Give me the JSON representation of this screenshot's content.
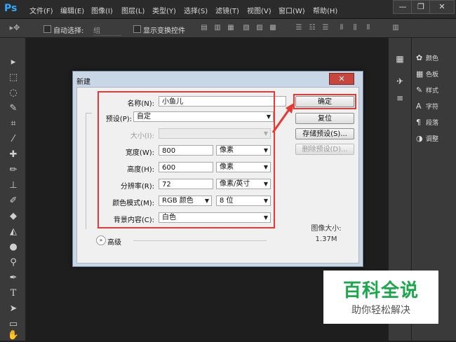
{
  "app": {
    "logo": "Ps"
  },
  "menu": [
    "文件(F)",
    "编辑(E)",
    "图像(I)",
    "图层(L)",
    "类型(Y)",
    "选择(S)",
    "滤镜(T)",
    "视图(V)",
    "窗口(W)",
    "帮助(H)"
  ],
  "window_controls": {
    "minimize": "—",
    "restore": "❐",
    "close": "✕"
  },
  "options_bar": {
    "auto_select_label": "自动选择:",
    "auto_select_value": "组",
    "show_transform_label": "显示变换控件"
  },
  "panels": [
    {
      "icon": "palette-icon",
      "label": "颜色"
    },
    {
      "icon": "grid-icon",
      "label": "色板"
    },
    {
      "icon": "style-icon",
      "label": "样式"
    },
    {
      "icon": "character-icon",
      "label": "字符"
    },
    {
      "icon": "paragraph-icon",
      "label": "段落"
    },
    {
      "icon": "adjust-icon",
      "label": "调整"
    }
  ],
  "dialog": {
    "title": "新建",
    "close_label": "✕",
    "name_label": "名称(N):",
    "name_value": "小鱼儿",
    "preset_label": "预设(P):",
    "preset_value": "自定",
    "size_label": "大小(I):",
    "size_value": "",
    "width_label": "宽度(W):",
    "width_value": "800",
    "width_unit": "像素",
    "height_label": "高度(H):",
    "height_value": "600",
    "height_unit": "像素",
    "resolution_label": "分辨率(R):",
    "resolution_value": "72",
    "resolution_unit": "像素/英寸",
    "color_mode_label": "颜色模式(M):",
    "color_mode_value": "RGB 颜色",
    "bit_depth_value": "8 位",
    "background_label": "背景内容(C):",
    "background_value": "白色",
    "advanced_label": "高级",
    "ok_label": "确定",
    "reset_label": "复位",
    "save_preset_label": "存储预设(S)...",
    "delete_preset_label": "删除预设(D)...",
    "image_size_label": "图像大小:",
    "image_size_value": "1.37M"
  },
  "watermark": {
    "title": "百科全说",
    "subtitle": "助你轻松解决"
  }
}
